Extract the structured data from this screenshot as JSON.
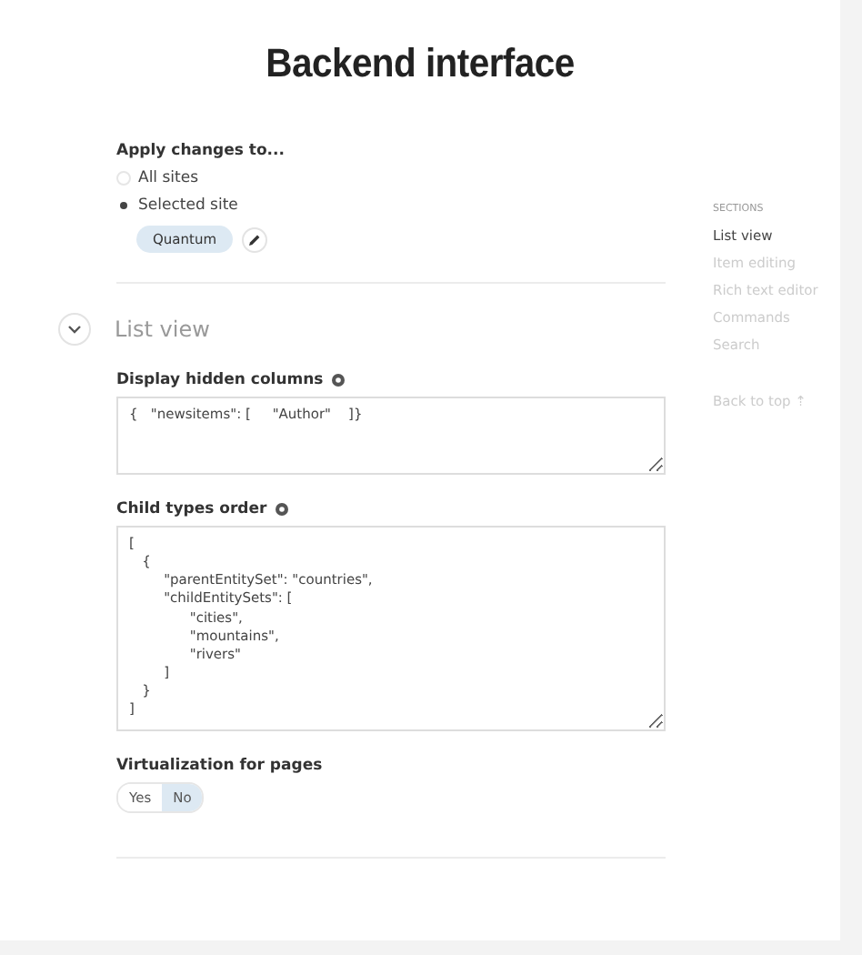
{
  "title": "Backend interface",
  "apply": {
    "label": "Apply changes to...",
    "options": [
      {
        "label": "All sites",
        "selected": false
      },
      {
        "label": "Selected site",
        "selected": true
      }
    ],
    "site_chip": "Quantum"
  },
  "section": {
    "title": "List view",
    "expanded": true
  },
  "fields": [
    {
      "label": "Display hidden columns",
      "value": "{   \"newsitems\": [     \"Author\"    ]}"
    },
    {
      "label": "Child types order",
      "value": "[\n   {\n        \"parentEntitySet\": \"countries\",\n        \"childEntitySets\": [\n              \"cities\",\n              \"mountains\",\n              \"rivers\"\n        ]\n   }\n]"
    }
  ],
  "virtualization": {
    "label": "Virtualization for pages",
    "options": [
      {
        "label": "Yes",
        "selected": false
      },
      {
        "label": "No",
        "selected": true
      }
    ]
  },
  "sidebar": {
    "heading": "SECTIONS",
    "items": [
      {
        "label": "List view",
        "selected": true
      },
      {
        "label": "Item editing",
        "selected": false
      },
      {
        "label": "Rich text editor",
        "selected": false
      },
      {
        "label": "Commands",
        "selected": false
      },
      {
        "label": "Search",
        "selected": false
      }
    ],
    "back_to_top": "Back to top ⇡"
  }
}
